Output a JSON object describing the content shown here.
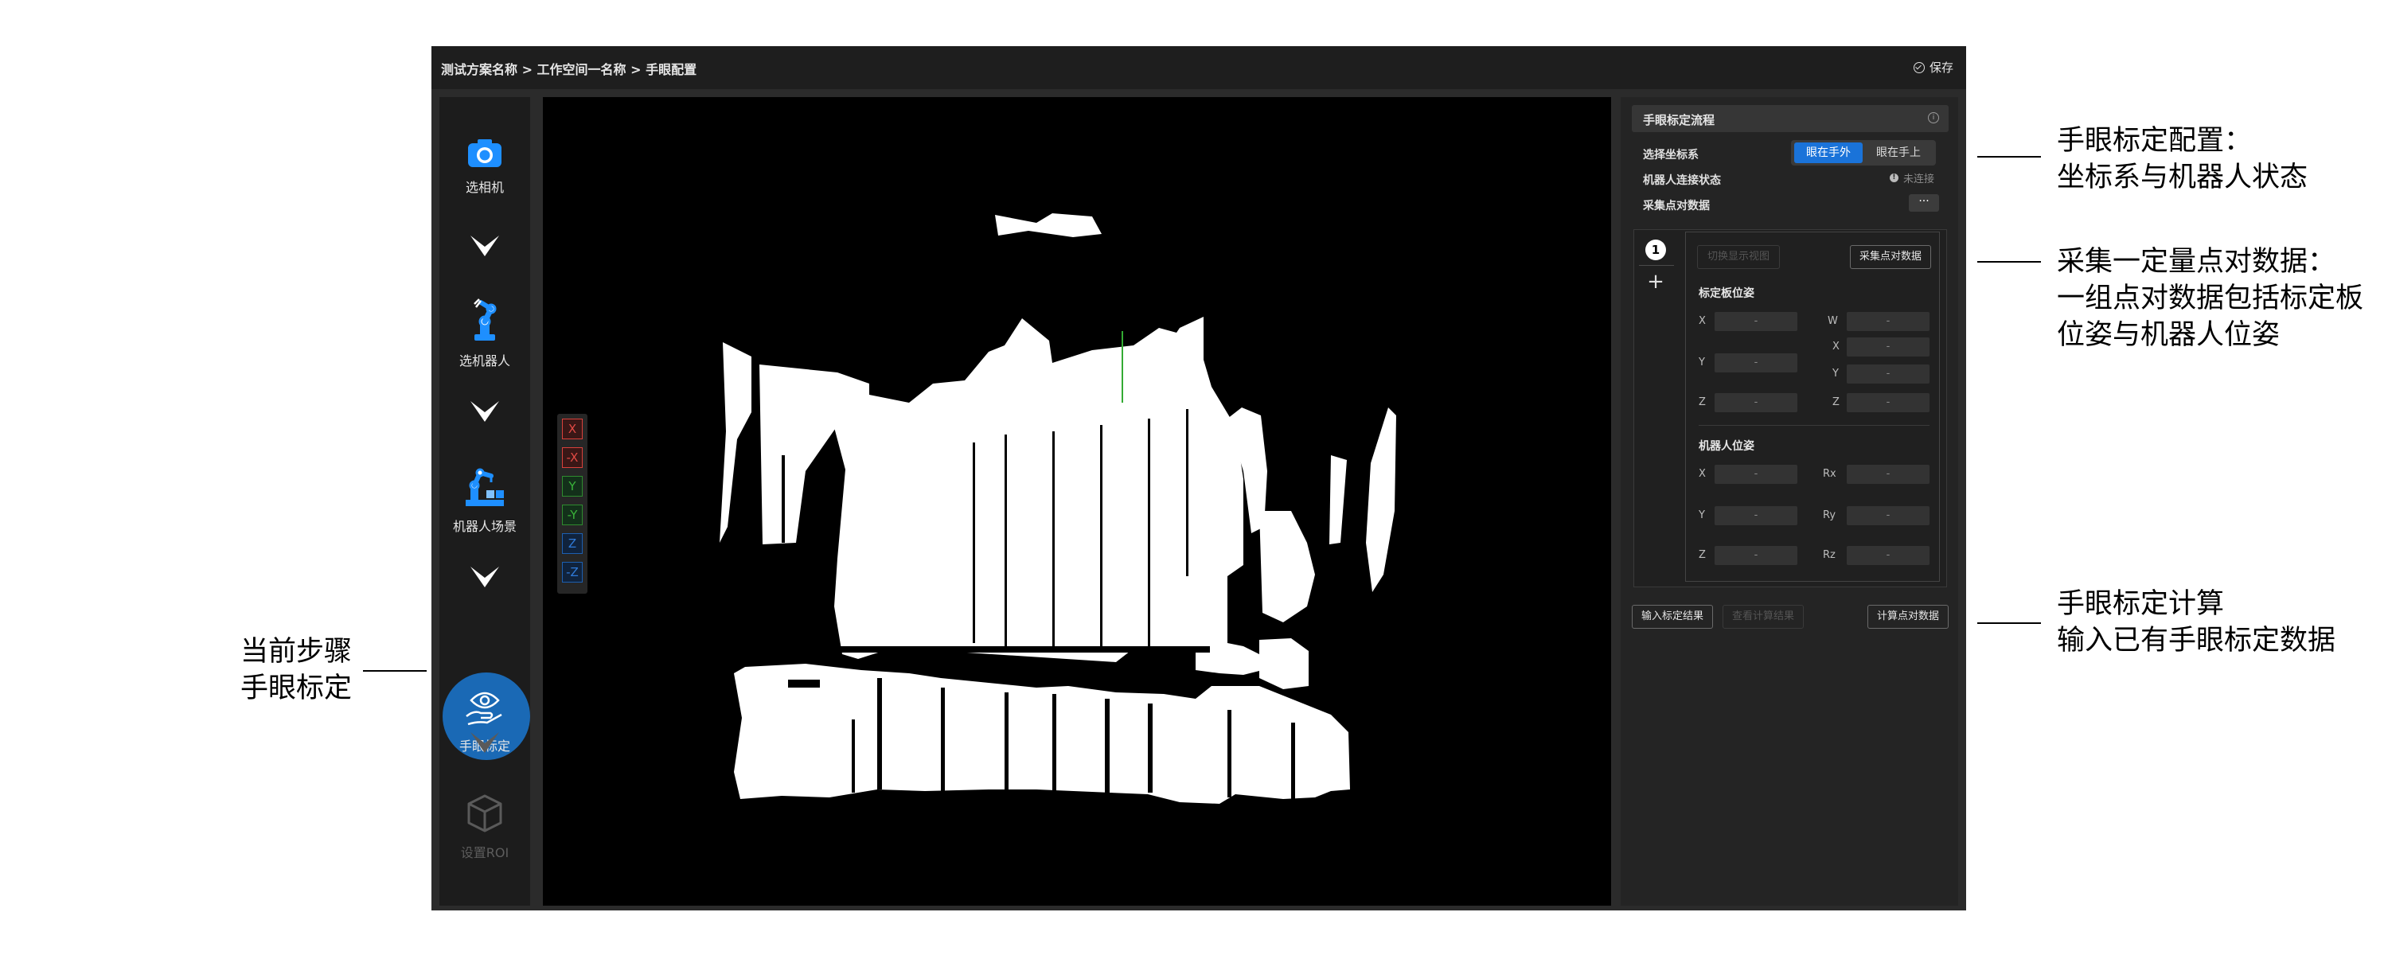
{
  "topbar": {
    "breadcrumb": "测试方案名称 > 工作空间一名称 > 手眼配置",
    "save_label": "保存"
  },
  "sidebar": {
    "steps": [
      {
        "label": "选相机",
        "icon": "camera-icon",
        "state": "done"
      },
      {
        "label": "选机器人",
        "icon": "robot-arm-icon",
        "state": "done"
      },
      {
        "label": "机器人场景",
        "icon": "robot-scene-icon",
        "state": "done"
      },
      {
        "label": "手眼标定",
        "icon": "hand-eye-icon",
        "state": "current"
      },
      {
        "label": "设置ROI",
        "icon": "cube-icon",
        "state": "disabled"
      }
    ]
  },
  "viewport": {
    "axis_buttons": [
      "X",
      "-X",
      "Y",
      "-Y",
      "Z",
      "-Z"
    ]
  },
  "panel": {
    "title": "手眼标定流程",
    "coord_label": "选择坐标系",
    "coord_options": [
      "眼在手外",
      "眼在手上"
    ],
    "coord_selected": "眼在手外",
    "robot_status_label": "机器人连接状态",
    "robot_status_value": "未连接",
    "collect_label": "采集点对数据",
    "more_label": "···",
    "tab_number": "1",
    "add_label": "+",
    "switch_view_label": "切换显示视图",
    "collect_button_label": "采集点对数据",
    "board_pose_title": "标定板位姿",
    "board_pose": {
      "x_label": "X",
      "x": "-",
      "y_label": "Y",
      "y": "-",
      "z_label": "Z",
      "z": "-",
      "w_label": "W",
      "w": "-",
      "qx_label": "X",
      "qx": "-",
      "qy_label": "Y",
      "qy": "-",
      "qz_label": "Z",
      "qz": "-"
    },
    "robot_pose_title": "机器人位姿",
    "robot_pose": {
      "x_label": "X",
      "x": "-",
      "y_label": "Y",
      "y": "-",
      "z_label": "Z",
      "z": "-",
      "rx_label": "Rx",
      "rx": "-",
      "ry_label": "Ry",
      "ry": "-",
      "rz_label": "Rz",
      "rz": "-"
    },
    "input_result_label": "输入标定结果",
    "view_result_label": "查看计算结果",
    "compute_label": "计算点对数据"
  },
  "annotations": {
    "config_line1": "手眼标定配置：",
    "config_line2": "坐标系与机器人状态",
    "collect_line1": "采集一定量点对数据：",
    "collect_line2": "一组点对数据包括标定板",
    "collect_line3": "位姿与机器人位姿",
    "compute_line1": "手眼标定计算",
    "compute_line2": "输入已有手眼标定数据",
    "current_line1": "当前步骤",
    "current_line2": "手眼标定"
  },
  "colors": {
    "accent": "#1a73d9",
    "current_step": "#1a69b5",
    "axis_x": "#d9413b",
    "axis_y": "#2f8b2f",
    "axis_z": "#1c5fb1"
  }
}
